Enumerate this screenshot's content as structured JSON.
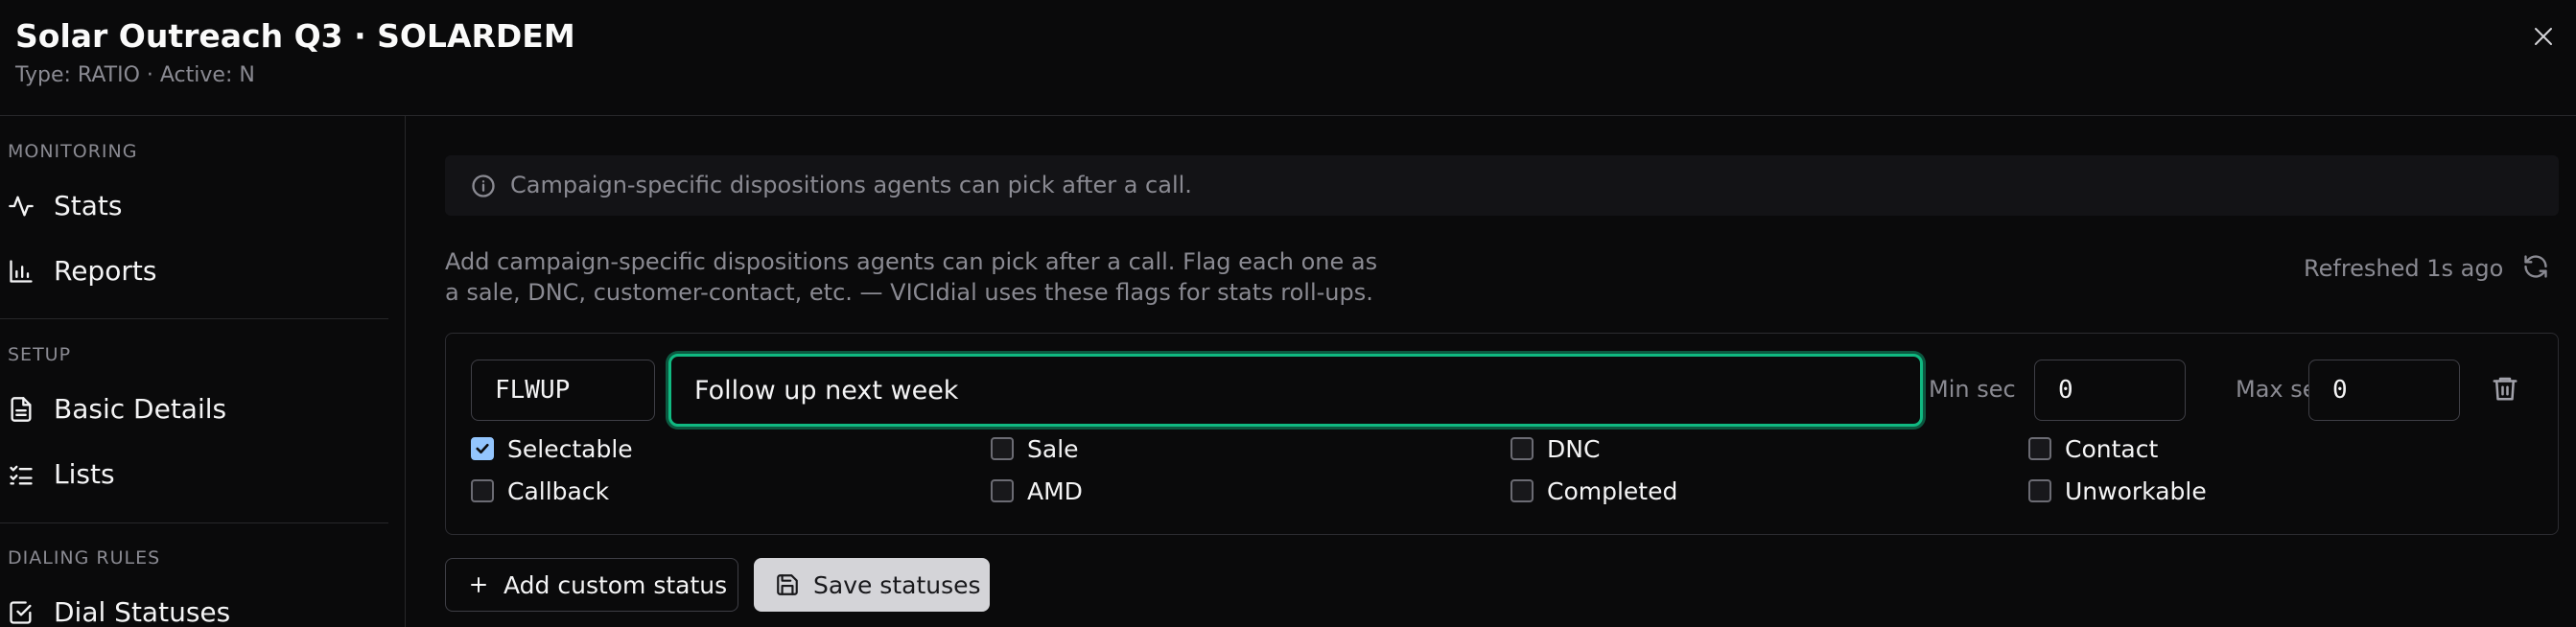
{
  "header": {
    "title": "Solar Outreach Q3 · SOLARDEM",
    "subtitle": "Type: RATIO · Active: N"
  },
  "sidebar": {
    "sections": [
      {
        "label": "MONITORING",
        "items": [
          {
            "label": "Stats",
            "icon": "activity-icon"
          },
          {
            "label": "Reports",
            "icon": "bar-chart-icon"
          }
        ]
      },
      {
        "label": "SETUP",
        "items": [
          {
            "label": "Basic Details",
            "icon": "file-text-icon"
          },
          {
            "label": "Lists",
            "icon": "list-checks-icon"
          }
        ]
      },
      {
        "label": "DIALING RULES",
        "items": [
          {
            "label": "Dial Statuses",
            "icon": "check-square-icon"
          }
        ]
      }
    ]
  },
  "main": {
    "info_text": "Campaign-specific dispositions agents can pick after a call.",
    "description_line1": "Add campaign-specific dispositions agents can pick after a call. Flag each one as",
    "description_line2": "a sale, DNC, customer-contact, etc. — VICIdial uses these flags for stats roll-ups.",
    "refreshed": "Refreshed 1s ago",
    "status": {
      "code": "FLWUP",
      "name": "Follow up next week",
      "min_label": "Min sec",
      "min_value": "0",
      "max_label": "Max sec",
      "max_value": "0",
      "flags": [
        {
          "label": "Selectable",
          "checked": true
        },
        {
          "label": "Sale",
          "checked": false
        },
        {
          "label": "DNC",
          "checked": false
        },
        {
          "label": "Contact",
          "checked": false
        },
        {
          "label": "Callback",
          "checked": false
        },
        {
          "label": "AMD",
          "checked": false
        },
        {
          "label": "Completed",
          "checked": false
        },
        {
          "label": "Unworkable",
          "checked": false
        }
      ]
    },
    "add_button": "Add custom status",
    "save_button": "Save statuses"
  },
  "colors": {
    "background": "#0a0a0b",
    "focus_ring": "#10b981",
    "checkbox_checked": "#93c5fd",
    "save_button_bg": "#d4d4d8"
  }
}
